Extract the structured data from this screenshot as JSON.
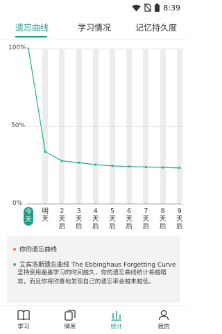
{
  "status_bar": {
    "time": "8:39",
    "icons": [
      "wifi-icon",
      "no-sim-icon",
      "battery-icon"
    ]
  },
  "tabs": [
    {
      "label": "遗忘曲线",
      "active": true
    },
    {
      "label": "学习情况",
      "active": false
    },
    {
      "label": "记忆持久度",
      "active": false
    }
  ],
  "chart_data": {
    "type": "line",
    "title": "",
    "xlabel": "",
    "ylabel": "",
    "y_tick_labels": [
      "100%",
      "50%",
      "0%"
    ],
    "ylim": [
      0,
      100
    ],
    "categories": [
      "今天",
      "明天",
      "2天后",
      "3天后",
      "4天后",
      "5天后",
      "6天后",
      "7天后",
      "8天后",
      "9天后"
    ],
    "selected_category": "今天",
    "series": [
      {
        "name": "你的遗忘曲线",
        "color": "#e07a4f",
        "values": [
          0,
          0,
          0,
          0,
          0,
          0,
          0,
          0,
          0,
          0
        ]
      },
      {
        "name": "艾宾浩斯遗忘曲线 The Ebbinghaus Forgetting Curve",
        "color": "#2bb39a",
        "values": [
          100,
          33.7,
          27.8,
          26.7,
          25.4,
          24.6,
          24.2,
          23.9,
          23.6,
          23.3
        ]
      }
    ],
    "grid": true
  },
  "legend": {
    "items": [
      {
        "label": "你的遗忘曲线",
        "color": "#e07a4f"
      },
      {
        "label": "艾宾浩斯遗忘曲线 The Ebbinghaus Forgetting Curve",
        "color": "#2bb39a"
      }
    ],
    "description": "坚持使用墨墨学习的时间越久，你的遗忘曲线统计将越精准，而且你将欣喜地发现自己的遗忘率会越来越低。"
  },
  "bottom_nav": [
    {
      "label": "学习",
      "icon": "book-icon",
      "active": false
    },
    {
      "label": "牌库",
      "icon": "cards-icon",
      "active": false
    },
    {
      "label": "统计",
      "icon": "bar-chart-icon",
      "active": true
    },
    {
      "label": "我的",
      "icon": "person-icon",
      "active": false
    }
  ],
  "colors": {
    "accent": "#1f9e86",
    "your_curve": "#e07a4f",
    "ebbinghaus_curve": "#2bb39a"
  }
}
